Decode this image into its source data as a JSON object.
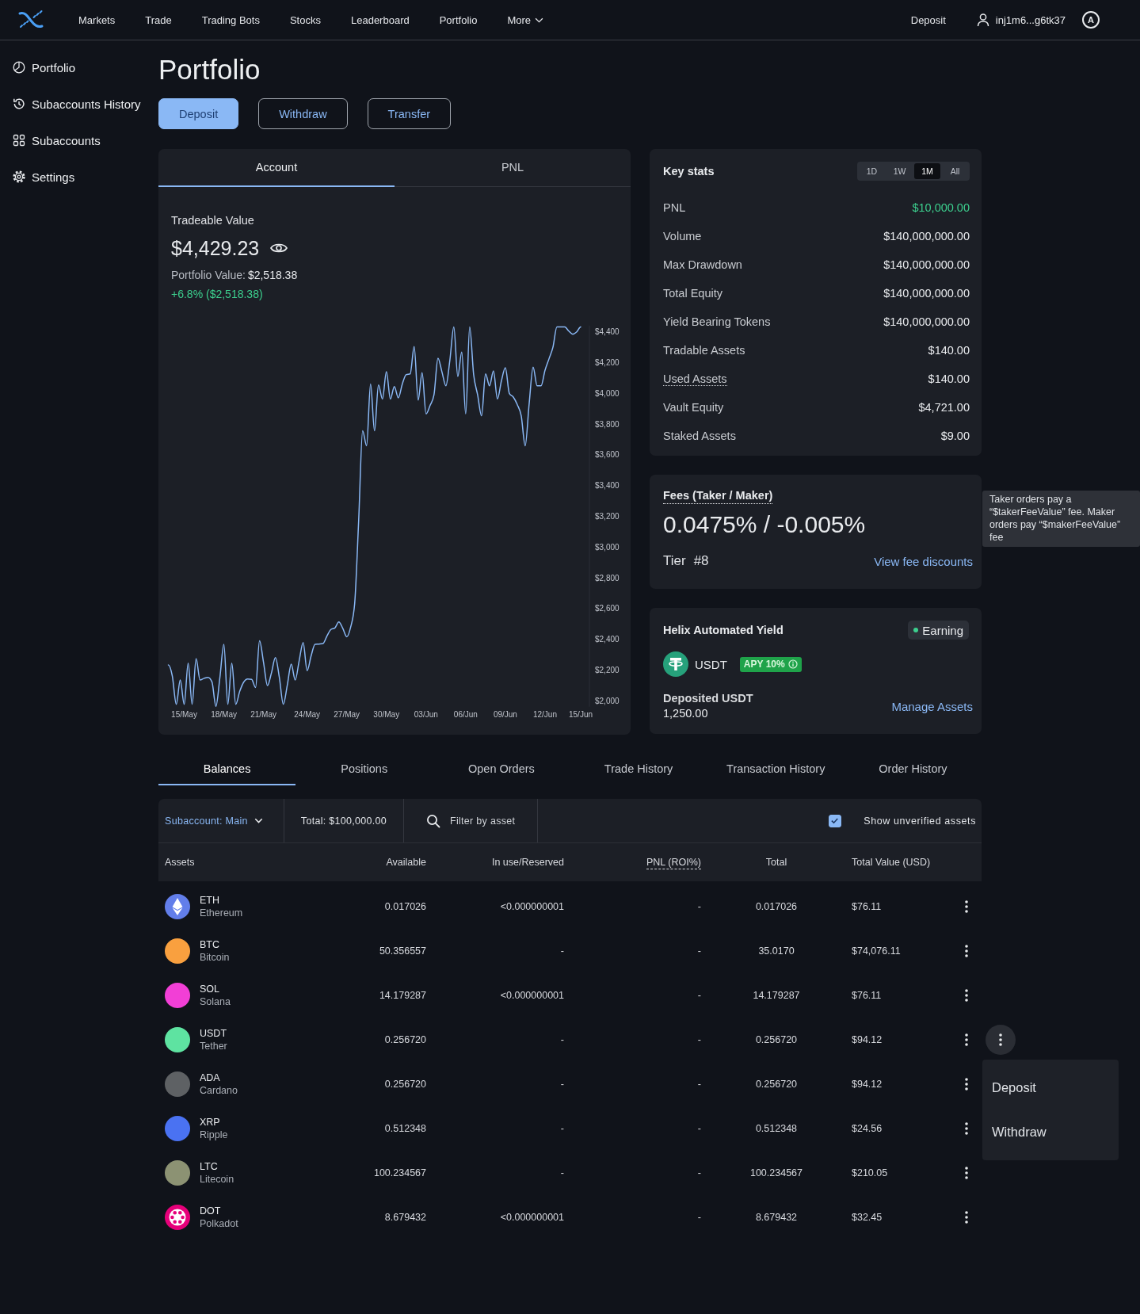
{
  "nav": {
    "links": [
      "Markets",
      "Trade",
      "Trading Bots",
      "Stocks",
      "Leaderboard",
      "Portfolio"
    ],
    "more": "More",
    "deposit": "Deposit",
    "account": "inj1m6...g6tk37",
    "badge": "A"
  },
  "sidebar": {
    "items": [
      {
        "label": "Portfolio",
        "kind": "pie"
      },
      {
        "label": "Subaccounts History",
        "kind": "history"
      },
      {
        "label": "Subaccounts",
        "kind": "grid"
      },
      {
        "label": "Settings",
        "kind": "gear"
      }
    ]
  },
  "page": {
    "title": "Portfolio",
    "actions": [
      {
        "label": "Deposit",
        "primary": true
      },
      {
        "label": "Withdraw",
        "primary": false
      },
      {
        "label": "Transfer",
        "primary": false
      }
    ]
  },
  "account": {
    "tabs": [
      {
        "label": "Account",
        "selected": true
      },
      {
        "label": "PNL",
        "selected": false
      }
    ],
    "tradeable_label": "Tradeable Value",
    "tradeable_value": "$4,429.23",
    "portfolio_label": "Portfolio Value:",
    "portfolio_value": "$2,518.38",
    "change": "+6.8% ($2,518.38)",
    "chart_data": {
      "type": "line",
      "categories": [
        null,
        null,
        null,
        null,
        "15/May",
        null,
        null,
        null,
        null,
        null,
        null,
        null,
        null,
        null,
        "18/May",
        null,
        null,
        null,
        null,
        null,
        null,
        null,
        null,
        null,
        "21/May",
        null,
        null,
        null,
        null,
        null,
        null,
        null,
        null,
        null,
        null,
        "24/May",
        null,
        null,
        null,
        null,
        null,
        null,
        null,
        null,
        null,
        "27/May",
        null,
        null,
        null,
        null,
        null,
        null,
        null,
        null,
        null,
        "30/May",
        null,
        null,
        null,
        null,
        null,
        null,
        null,
        null,
        null,
        "03/Jun",
        null,
        null,
        null,
        null,
        null,
        null,
        null,
        null,
        null,
        "06/Jun",
        null,
        null,
        null,
        null,
        null,
        null,
        null,
        null,
        null,
        "09/Jun",
        null,
        null,
        null,
        null,
        null,
        null,
        null,
        null,
        null,
        "12/Jun",
        null,
        null,
        null,
        null,
        null,
        null,
        null,
        null,
        "15/Jun"
      ],
      "values": [
        2232,
        2160,
        1976,
        2134,
        1976,
        2244,
        1976,
        2273,
        2134,
        2145,
        2151,
        2122,
        1963,
        2150,
        2366,
        1976,
        2244,
        1976,
        2060,
        2120,
        2141,
        2138,
        2085,
        2390,
        2250,
        2098,
        2180,
        2280,
        2150,
        1976,
        2100,
        2237,
        2134,
        2260,
        2378,
        2195,
        2290,
        2366,
        2368,
        2371,
        2420,
        2463,
        2473,
        2512,
        2470,
        2415,
        2480,
        2634,
        3171,
        3756,
        3659,
        4061,
        3756,
        4054,
        3963,
        4141,
        3963,
        4044,
        3971,
        4060,
        4122,
        4127,
        4305,
        3956,
        4134,
        3866,
        3920,
        3990,
        4229,
        4140,
        4049,
        4215,
        4432,
        4110,
        4268,
        3866,
        4432,
        4122,
        3990,
        3854,
        4127,
        4049,
        4146,
        3963,
        4080,
        4166,
        4000,
        3976,
        3927,
        3854,
        3659,
        3932,
        4171,
        4049,
        4049,
        4150,
        4224,
        4300,
        4432,
        4432,
        4432,
        4405,
        4385,
        4400,
        4432
      ],
      "ylim": [
        1960,
        4440
      ],
      "yticks": [
        {
          "value": 2000,
          "label": "$2,000"
        },
        {
          "value": 2200,
          "label": "$2,200"
        },
        {
          "value": 2400,
          "label": "$2,400"
        },
        {
          "value": 2600,
          "label": "$2,600"
        },
        {
          "value": 2800,
          "label": "$2,800"
        },
        {
          "value": 3000,
          "label": "$3,000"
        },
        {
          "value": 3200,
          "label": "$3,200"
        },
        {
          "value": 3400,
          "label": "$3,400"
        },
        {
          "value": 3600,
          "label": "$3,600"
        },
        {
          "value": 3800,
          "label": "$3,800"
        },
        {
          "value": 4000,
          "label": "$4,000"
        },
        {
          "value": 4200,
          "label": "$4,200"
        },
        {
          "value": 4400,
          "label": "$4,400"
        }
      ]
    }
  },
  "key_stats": {
    "title": "Key stats",
    "periods": [
      {
        "label": "1D",
        "selected": false
      },
      {
        "label": "1W",
        "selected": false
      },
      {
        "label": "1M",
        "selected": true
      },
      {
        "label": "All",
        "selected": false
      }
    ],
    "rows": [
      {
        "label": "PNL",
        "value": "$10,000.00",
        "positive": true,
        "underlined": false
      },
      {
        "label": "Volume",
        "value": "$140,000,000.00",
        "positive": false,
        "underlined": false
      },
      {
        "label": "Max Drawdown",
        "value": "$140,000,000.00",
        "positive": false,
        "underlined": false
      },
      {
        "label": "Total Equity",
        "value": "$140,000,000.00",
        "positive": false,
        "underlined": false
      },
      {
        "label": "Yield Bearing Tokens",
        "value": "$140,000,000.00",
        "positive": false,
        "underlined": false
      },
      {
        "label": "Tradable Assets",
        "value": "$140.00",
        "positive": false,
        "underlined": false
      },
      {
        "label": "Used Assets",
        "value": "$140.00",
        "positive": false,
        "underlined": true
      },
      {
        "label": "Vault Equity",
        "value": "$4,721.00",
        "positive": false,
        "underlined": false
      },
      {
        "label": "Staked Assets",
        "value": "$9.00",
        "positive": false,
        "underlined": false
      }
    ]
  },
  "fees": {
    "title": "Fees (Taker / Maker)",
    "value": "0.0475% / -0.005%",
    "tier_label": "Tier",
    "tier": "#8",
    "link": "View fee discounts",
    "tooltip": "Taker orders pay a “$takerFeeValue” fee. Maker orders pay “$makerFeeValue” fee"
  },
  "yield": {
    "title": "Helix Automated Yield",
    "status": "Earning",
    "asset": "USDT",
    "apy": "APY 10%",
    "deposited_label": "Deposited USDT",
    "deposited_value": "1,250.00",
    "link": "Manage Assets"
  },
  "balances": {
    "tabs": [
      {
        "label": "Balances",
        "selected": true
      },
      {
        "label": "Positions",
        "selected": false
      },
      {
        "label": "Open Orders",
        "selected": false
      },
      {
        "label": "Trade History",
        "selected": false
      },
      {
        "label": "Transaction History",
        "selected": false
      },
      {
        "label": "Order History",
        "selected": false
      }
    ],
    "subaccount": "Subaccount: Main",
    "total": "Total: $100,000.00",
    "search": {
      "placeholder": "Filter by asset"
    },
    "show_unverified": {
      "label": "Show unverified assets",
      "checked": true
    },
    "columns": [
      {
        "label": "Assets",
        "dotted": false
      },
      {
        "label": "Available",
        "dotted": false
      },
      {
        "label": "In use/Reserved",
        "dotted": false
      },
      {
        "label": "PNL (ROI%)",
        "dotted": true
      },
      {
        "label": "Total",
        "dotted": false
      },
      {
        "label": "Total Value (USD)",
        "dotted": false
      }
    ],
    "rows": [
      {
        "symbol": "ETH",
        "name": "Ethereum",
        "kind": "diamond",
        "color": "#627eea",
        "available": "0.017026",
        "in_use": "<0.000000001",
        "pnl": "-",
        "total": "0.017026",
        "value": "$76.11",
        "expanded": false
      },
      {
        "symbol": "BTC",
        "name": "Bitcoin",
        "kind": "plain",
        "color": "#f9a03f",
        "available": "50.356557",
        "in_use": "-",
        "pnl": "-",
        "total": "35.0170",
        "value": "$74,076.11",
        "expanded": false
      },
      {
        "symbol": "SOL",
        "name": "Solana",
        "kind": "plain",
        "color": "#f23fd6",
        "available": "14.179287",
        "in_use": "<0.000000001",
        "pnl": "-",
        "total": "14.179287",
        "value": "$76.11",
        "expanded": false
      },
      {
        "symbol": "USDT",
        "name": "Tether",
        "kind": "plain",
        "color": "#5ee3a1",
        "available": "0.256720",
        "in_use": "-",
        "pnl": "-",
        "total": "0.256720",
        "value": "$94.12",
        "expanded": true
      },
      {
        "symbol": "ADA",
        "name": "Cardano",
        "kind": "plain",
        "color": "#5e6164",
        "available": "0.256720",
        "in_use": "-",
        "pnl": "-",
        "total": "0.256720",
        "value": "$94.12",
        "expanded": false
      },
      {
        "symbol": "XRP",
        "name": "Ripple",
        "kind": "plain",
        "color": "#4a72f2",
        "available": "0.512348",
        "in_use": "-",
        "pnl": "-",
        "total": "0.512348",
        "value": "$24.56",
        "expanded": false
      },
      {
        "symbol": "LTC",
        "name": "Litecoin",
        "kind": "plain",
        "color": "#8c9273",
        "available": "100.234567",
        "in_use": "-",
        "pnl": "-",
        "total": "100.234567",
        "value": "$210.05",
        "expanded": false
      },
      {
        "symbol": "DOT",
        "name": "Polkadot",
        "kind": "dotring",
        "color": "#e6007a",
        "available": "8.679432",
        "in_use": "<0.000000001",
        "pnl": "-",
        "total": "8.679432",
        "value": "$32.45",
        "expanded": false
      }
    ],
    "row_menu": [
      "Deposit",
      "Withdraw"
    ]
  }
}
